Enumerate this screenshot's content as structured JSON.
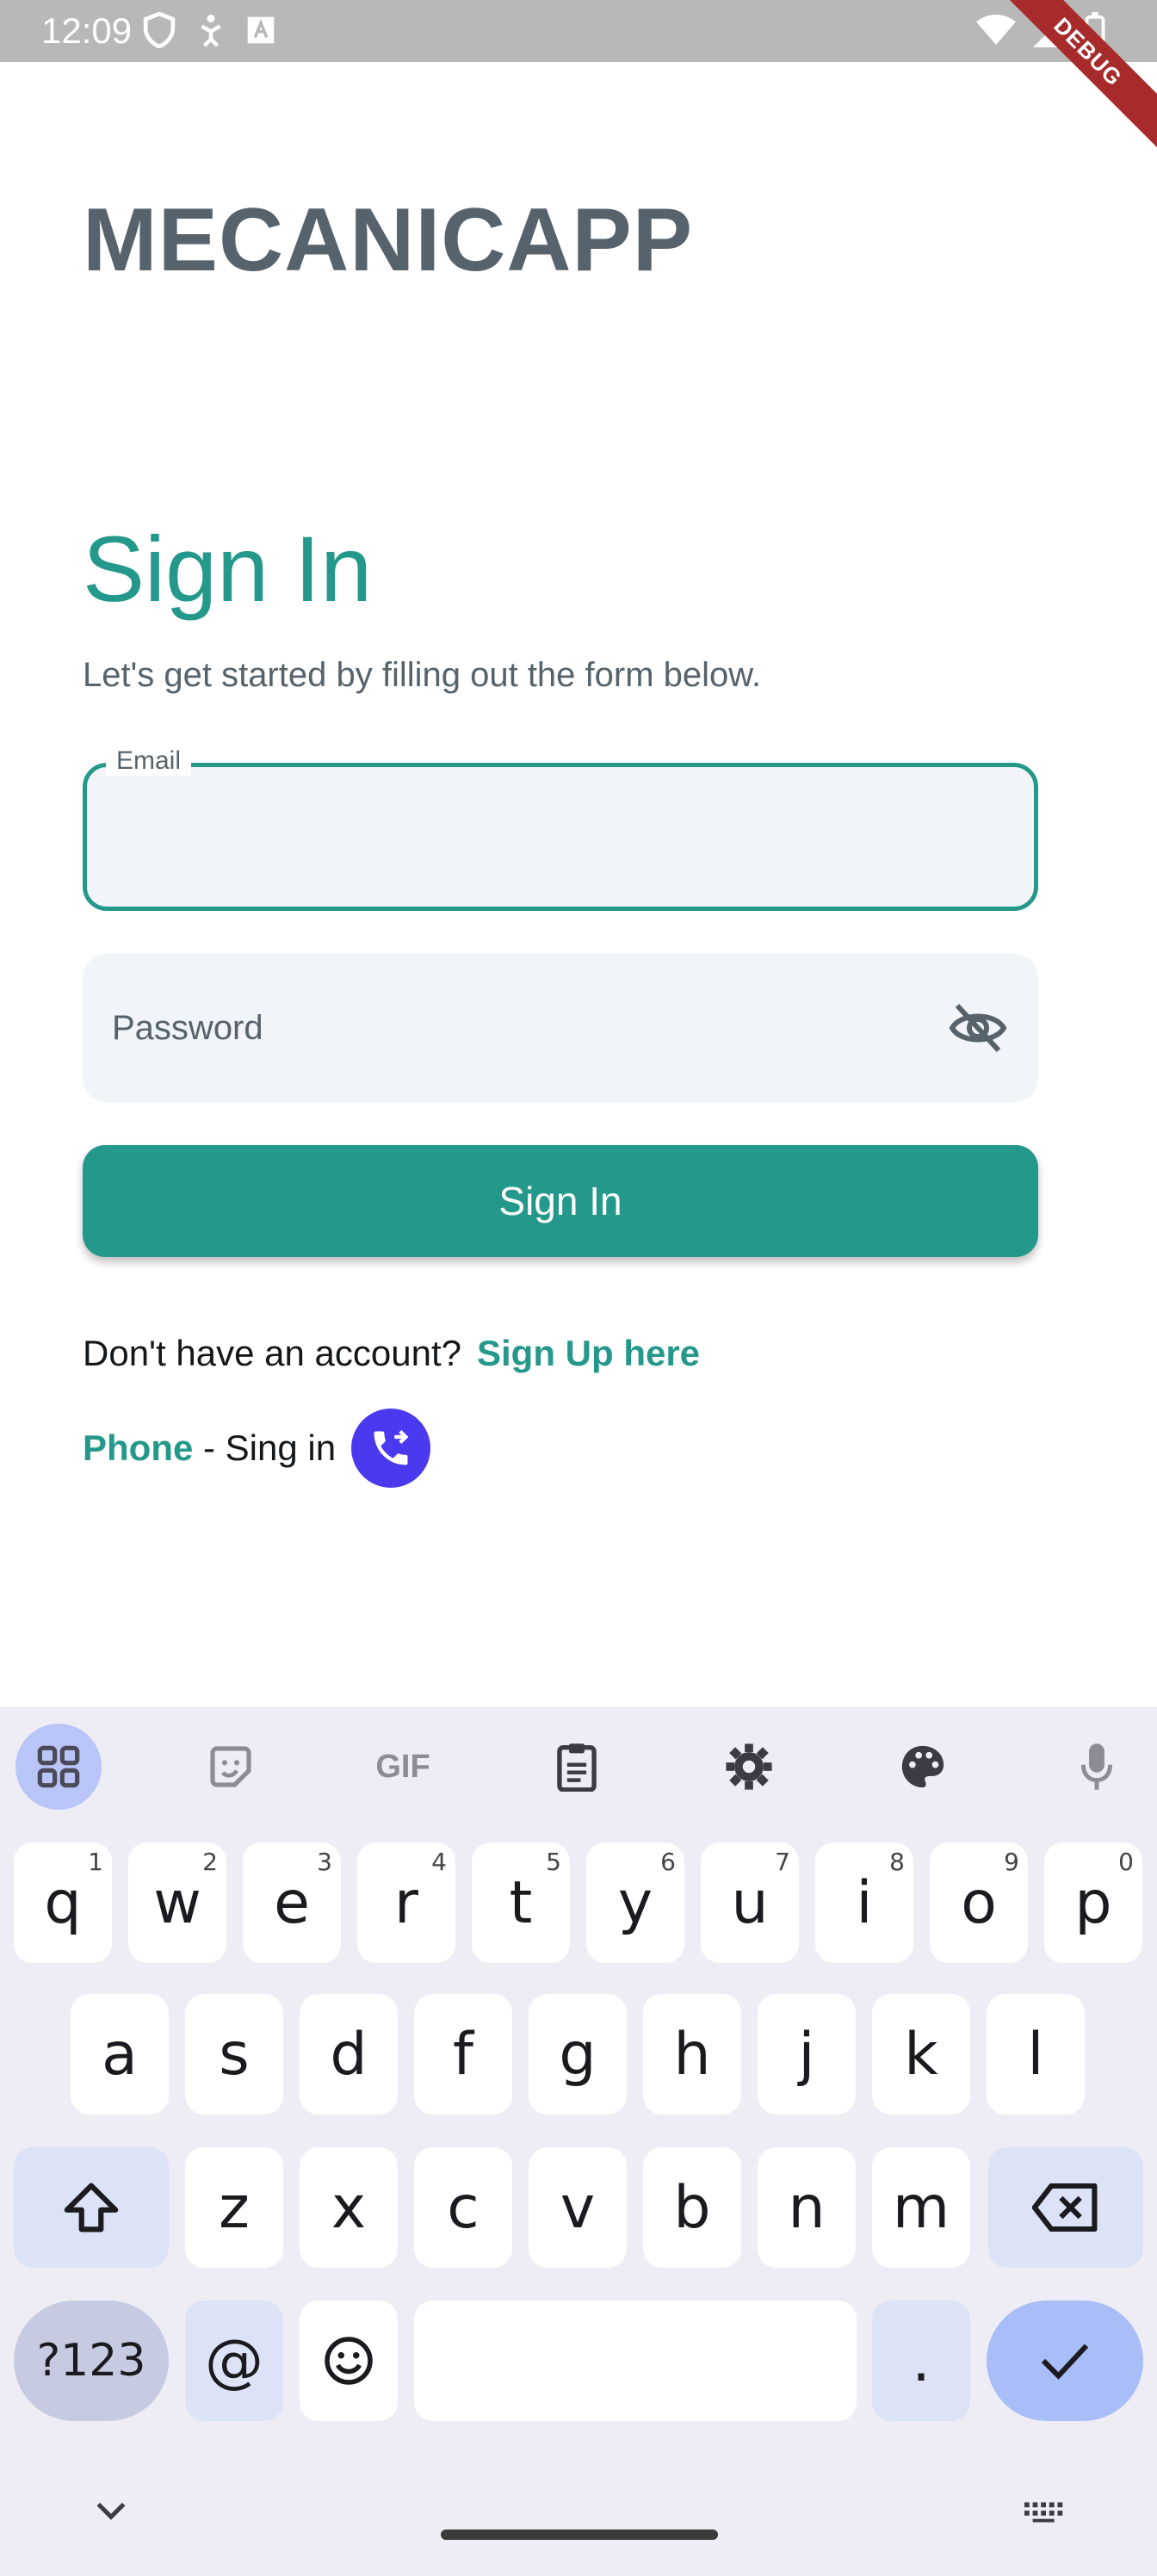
{
  "status_bar": {
    "time": "12:09",
    "debug_label": "DEBUG"
  },
  "app": {
    "title": "MECANICAPP",
    "heading": "Sign In",
    "subtitle": "Let's get started by filling out the form below.",
    "email": {
      "label": "Email",
      "value": ""
    },
    "password": {
      "placeholder": "Password"
    },
    "signin_button": "Sign In",
    "account_prompt": "Don't have an account?",
    "signup_link": "Sign Up here",
    "phone_link": "Phone",
    "phone_suffix": " - Sing in"
  },
  "colors": {
    "accent": "#24988a",
    "phone_button": "#4b39ef",
    "title": "#57636c"
  },
  "keyboard": {
    "toolbar_gif": "GIF",
    "row1": [
      [
        "q",
        "1"
      ],
      [
        "w",
        "2"
      ],
      [
        "e",
        "3"
      ],
      [
        "r",
        "4"
      ],
      [
        "t",
        "5"
      ],
      [
        "y",
        "6"
      ],
      [
        "u",
        "7"
      ],
      [
        "i",
        "8"
      ],
      [
        "o",
        "9"
      ],
      [
        "p",
        "0"
      ]
    ],
    "row2": [
      "a",
      "s",
      "d",
      "f",
      "g",
      "h",
      "j",
      "k",
      "l"
    ],
    "row3": [
      "z",
      "x",
      "c",
      "v",
      "b",
      "n",
      "m"
    ],
    "sym_key": "?123",
    "at_key": "@",
    "period_key": "."
  }
}
